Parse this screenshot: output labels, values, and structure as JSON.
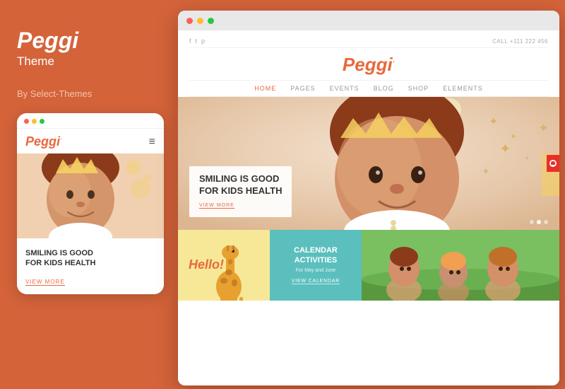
{
  "background_color": "#d4633a",
  "left_panel": {
    "title": "Peggi",
    "subtitle": "Theme",
    "byline": "By Select-Themes",
    "mobile": {
      "logo": "Peggi",
      "logo_sup": "·",
      "hamburger": "≡",
      "hero_text": "SMILING IS GOOD\nFOR KIDS HEALTH",
      "view_more": "VIEW MORE"
    }
  },
  "desktop": {
    "social_icons": [
      "f",
      "t",
      "p"
    ],
    "call_label": "CALL",
    "call_number": "+111 222 456",
    "logo": "Peggi",
    "logo_sup": "·",
    "nav_items": [
      {
        "label": "HOME",
        "active": true
      },
      {
        "label": "PAGES",
        "active": false
      },
      {
        "label": "EVENTS",
        "active": false
      },
      {
        "label": "BLOG",
        "active": false
      },
      {
        "label": "SHOP",
        "active": false
      },
      {
        "label": "ELEMENTS",
        "active": false
      }
    ],
    "hero": {
      "title": "SMILING IS GOOD\nFOR KIDS HEALTH",
      "cta": "VIEW MORE"
    },
    "cards": [
      {
        "id": "hello",
        "type": "hello",
        "text": "Hello!"
      },
      {
        "id": "calendar",
        "type": "calendar",
        "title": "CALENDAR ACTIVITIES",
        "subtitle": "For May and June",
        "link": "VIEW CALENDAR"
      },
      {
        "id": "photo",
        "type": "photo"
      }
    ]
  }
}
